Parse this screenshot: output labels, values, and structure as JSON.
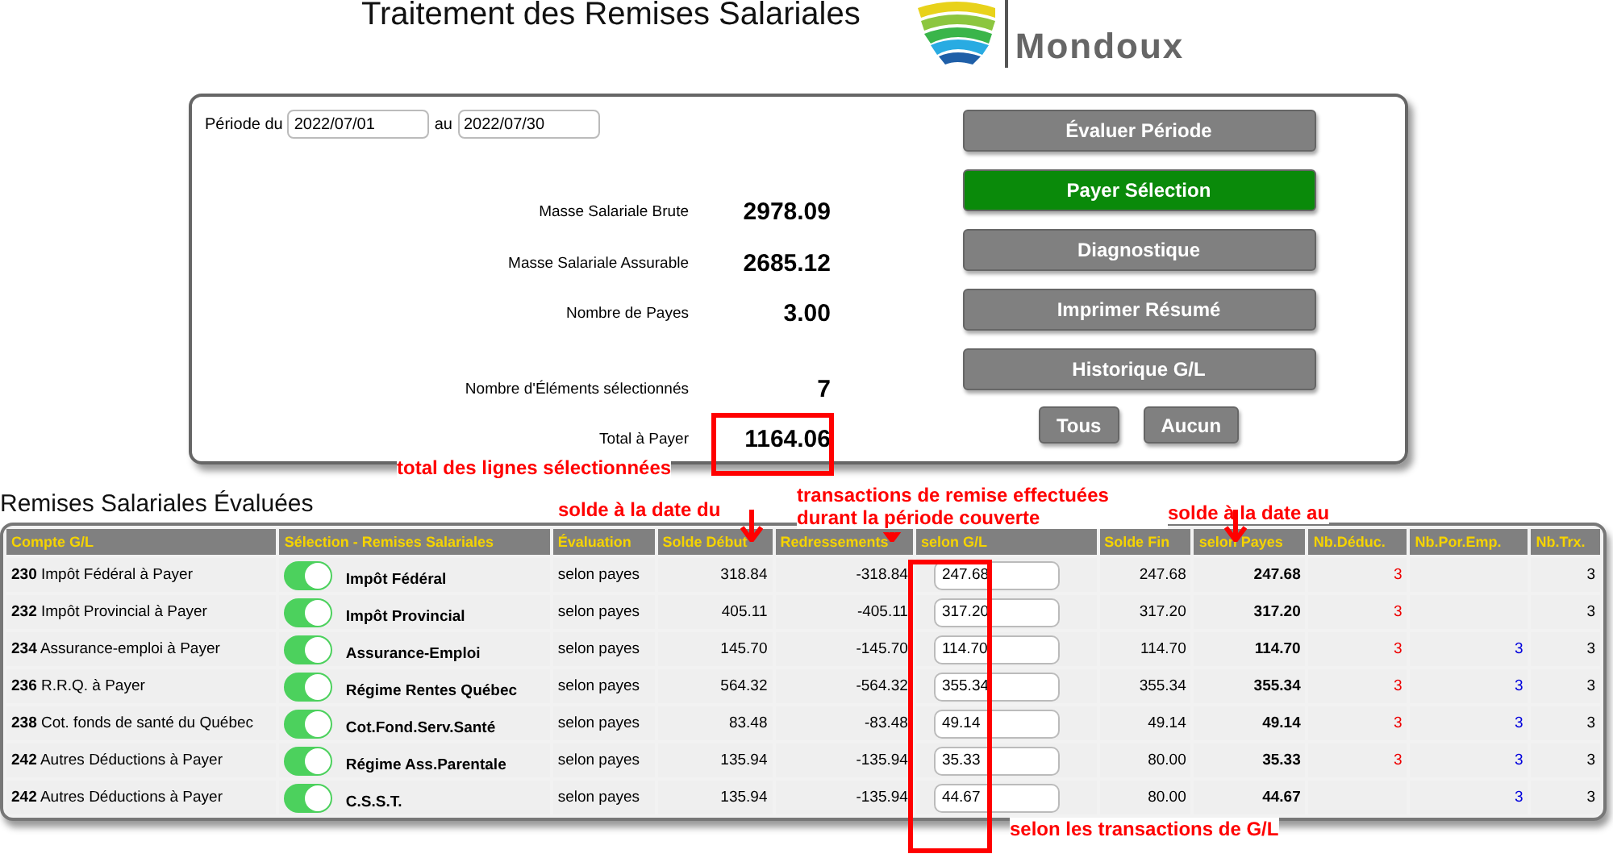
{
  "title": "Traitement des Remises Salariales",
  "logo": {
    "name": "Mondoux"
  },
  "period": {
    "from_label": "Période du",
    "from": "2022/07/01",
    "to_label": "au",
    "to": "2022/07/30"
  },
  "stats": [
    {
      "label": "Masse Salariale Brute",
      "value": "2978.09"
    },
    {
      "label": "Masse Salariale Assurable",
      "value": "2685.12"
    },
    {
      "label": "Nombre de Payes",
      "value": "3.00"
    },
    {
      "label": "Nombre d'Éléments sélectionnés",
      "value": "7"
    },
    {
      "label": "Total à Payer",
      "value": "1164.06"
    }
  ],
  "buttons": [
    {
      "label": "Évaluer Période",
      "kind": "default"
    },
    {
      "label": "Payer Sélection",
      "kind": "primary"
    },
    {
      "label": "Diagnostique",
      "kind": "default"
    },
    {
      "label": "Imprimer Résumé",
      "kind": "default"
    },
    {
      "label": "Historique G/L",
      "kind": "default"
    }
  ],
  "select_buttons": [
    "Tous",
    "Aucun"
  ],
  "section_title": "Remises Salariales Évaluées",
  "table": {
    "columns": [
      "Compte G/L",
      "Sélection - Remises Salariales",
      "Évaluation",
      "Solde Début",
      "Redressements",
      "selon G/L",
      "Solde Fin",
      "selon Payes",
      "Nb.Déduc.",
      "Nb.Por.Emp.",
      "Nb.Trx."
    ],
    "rows": [
      {
        "account_number": "230",
        "account_name": "Impôt Fédéral à Payer",
        "on": true,
        "remittance": "Impôt Fédéral",
        "evaluation": "selon payes",
        "opening": "318.84",
        "adjustments": "-318.84",
        "per_gl": "247.68",
        "closing": "247.68",
        "per_pays": "247.68",
        "nb_deduc": "3",
        "nb_trx": "3"
      },
      {
        "account_number": "232",
        "account_name": "Impôt Provincial à Payer",
        "on": true,
        "remittance": "Impôt Provincial",
        "evaluation": "selon payes",
        "opening": "405.11",
        "adjustments": "-405.11",
        "per_gl": "317.20",
        "closing": "317.20",
        "per_pays": "317.20",
        "nb_deduc": "3",
        "nb_trx": "3"
      },
      {
        "account_number": "234",
        "account_name": "Assurance-emploi à Payer",
        "on": true,
        "remittance": "Assurance-Emploi",
        "evaluation": "selon payes",
        "opening": "145.70",
        "adjustments": "-145.70",
        "per_gl": "114.70",
        "closing": "114.70",
        "per_pays": "114.70",
        "nb_deduc": "3",
        "nb_por_emp": "3",
        "nb_trx": "3"
      },
      {
        "account_number": "236",
        "account_name": "R.R.Q. à Payer",
        "on": true,
        "remittance": "Régime Rentes Québec",
        "evaluation": "selon payes",
        "opening": "564.32",
        "adjustments": "-564.32",
        "per_gl": "355.34",
        "closing": "355.34",
        "per_pays": "355.34",
        "nb_deduc": "3",
        "nb_por_emp": "3",
        "nb_trx": "3"
      },
      {
        "account_number": "238",
        "account_name": "Cot. fonds de santé du Québec",
        "on": true,
        "remittance": "Cot.Fond.Serv.Santé",
        "evaluation": "selon payes",
        "opening": "83.48",
        "adjustments": "-83.48",
        "per_gl": "49.14",
        "closing": "49.14",
        "per_pays": "49.14",
        "nb_deduc": "3",
        "nb_por_emp": "3",
        "nb_trx": "3"
      },
      {
        "account_number": "242",
        "account_name": "Autres Déductions à Payer",
        "on": true,
        "remittance": "Régime Ass.Parentale",
        "evaluation": "selon payes",
        "opening": "135.94",
        "adjustments": "-135.94",
        "per_gl": "35.33",
        "closing": "80.00",
        "per_pays": "35.33",
        "nb_deduc": "3",
        "nb_por_emp": "3",
        "nb_trx": "3"
      },
      {
        "account_number": "242",
        "account_name": "Autres Déductions à Payer",
        "on": true,
        "remittance": "C.S.S.T.",
        "evaluation": "selon payes",
        "opening": "135.94",
        "adjustments": "-135.94",
        "per_gl": "44.67",
        "closing": "80.00",
        "per_pays": "44.67",
        "nb_por_emp": "3",
        "nb_trx": "3"
      }
    ]
  },
  "annotations": [
    {
      "kind": "total",
      "text": "total des lignes sélectionnées"
    },
    {
      "kind": "opening",
      "text": "solde à la date du"
    },
    {
      "kind": "adjustments",
      "text": "transactions de remise effectuées durant  la période couverte"
    },
    {
      "kind": "closing",
      "text": "solde à la date au"
    },
    {
      "kind": "gl",
      "text": "selon les transactions de G/L"
    }
  ]
}
